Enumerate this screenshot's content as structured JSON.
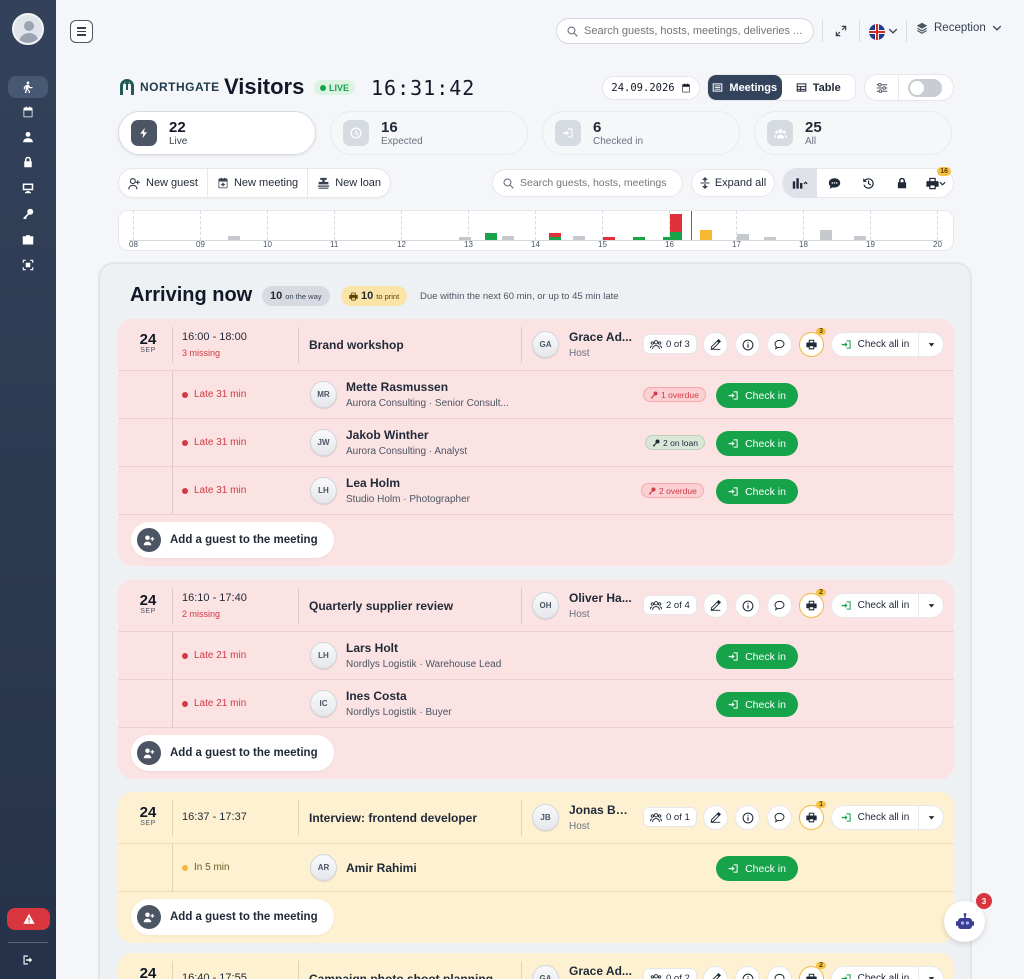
{
  "header": {
    "search_placeholder": "Search guests, hosts, meetings, deliveries ...",
    "location": "Reception",
    "brand": "NORTHGATE",
    "title": "Visitors",
    "live_label": "LIVE",
    "clock": "16:31:42",
    "date": "24.09.2026",
    "view_meetings": "Meetings",
    "view_table": "Table"
  },
  "stats": [
    {
      "value": "22",
      "label": "Live"
    },
    {
      "value": "16",
      "label": "Expected"
    },
    {
      "value": "6",
      "label": "Checked in"
    },
    {
      "value": "25",
      "label": "All"
    }
  ],
  "toolbar": {
    "new_guest": "New guest",
    "new_meeting": "New meeting",
    "new_loan": "New loan",
    "search_placeholder": "Search guests, hosts, meetings",
    "expand_all": "Expand all",
    "print_count": "16"
  },
  "timeline": {
    "ticks": [
      "08",
      "09",
      "10",
      "11",
      "12",
      "13",
      "14",
      "15",
      "16",
      "17",
      "18",
      "19",
      "20"
    ]
  },
  "chart_data": {
    "type": "bar",
    "categories": [
      "08",
      "09",
      "10",
      "11",
      "12",
      "13",
      "14",
      "15",
      "16",
      "17",
      "18",
      "19",
      "20"
    ],
    "series_colors": {
      "grey": "#c5c8cd",
      "green": "#16a34a",
      "red": "#e0303a",
      "yellow": "#f7b731"
    },
    "now_marker": "16:31"
  },
  "arriving": {
    "title": "Arriving now",
    "on_the_way_count": "10",
    "on_the_way_label": "on the way",
    "to_print_count": "10",
    "to_print_label": "to print",
    "note": "Due within the next 60 min, or up to 45 min late",
    "add_guest_label": "Add a guest to the meeting",
    "check_all_label": "Check all in",
    "check_in_label": "Check in"
  },
  "meetings": [
    {
      "day": "24",
      "month": "SEP",
      "time": "16:00 - 18:00",
      "missing": "3 missing",
      "title": "Brand workshop",
      "host_initials": "GA",
      "host": "Grace Ad...",
      "host_role": "Host",
      "guests_count": "0 of 3",
      "print_count": "3",
      "guests": [
        {
          "status": "Late 31 min",
          "initials": "MR",
          "name": "Mette Rasmussen",
          "org": "Aurora Consulting · Senior Consult...",
          "loan": "1 overdue"
        },
        {
          "status": "Late 31 min",
          "initials": "JW",
          "name": "Jakob Winther",
          "org": "Aurora Consulting · Analyst",
          "loan": "2 on loan"
        },
        {
          "status": "Late 31 min",
          "initials": "LH",
          "name": "Lea Holm",
          "org": "Studio Holm · Photographer",
          "loan": "2 overdue"
        }
      ]
    },
    {
      "day": "24",
      "month": "SEP",
      "time": "16:10 - 17:40",
      "missing": "2 missing",
      "title": "Quarterly supplier review",
      "host_initials": "OH",
      "host": "Oliver Ha...",
      "host_role": "Host",
      "guests_count": "2 of 4",
      "print_count": "2",
      "guests": [
        {
          "status": "Late 21 min",
          "initials": "LH",
          "name": "Lars Holt",
          "org": "Nordlys Logistik · Warehouse Lead"
        },
        {
          "status": "Late 21 min",
          "initials": "IC",
          "name": "Ines Costa",
          "org": "Nordlys Logistik · Buyer"
        }
      ]
    },
    {
      "day": "24",
      "month": "SEP",
      "time": "16:37 - 17:37",
      "title": "Interview: frontend developer",
      "host_initials": "JB",
      "host": "Jonas Berg",
      "host_role": "Host",
      "guests_count": "0 of 1",
      "print_count": "1",
      "guests": [
        {
          "status": "In 5 min",
          "initials": "AR",
          "name": "Amir Rahimi"
        }
      ]
    },
    {
      "day": "24",
      "month": "SEP",
      "time": "16:40 - 17:55",
      "title": "Campaign photo shoot planning",
      "host_initials": "GA",
      "host": "Grace Ad...",
      "host_role": "Host",
      "guests_count": "0 of 2",
      "print_count": "2"
    }
  ],
  "bot": {
    "badge": "3"
  },
  "colors": {
    "sidebar": "#2c3a52",
    "accent_green": "#16a34a",
    "late_red": "#d23a45",
    "print_yellow": "#f6c244"
  }
}
